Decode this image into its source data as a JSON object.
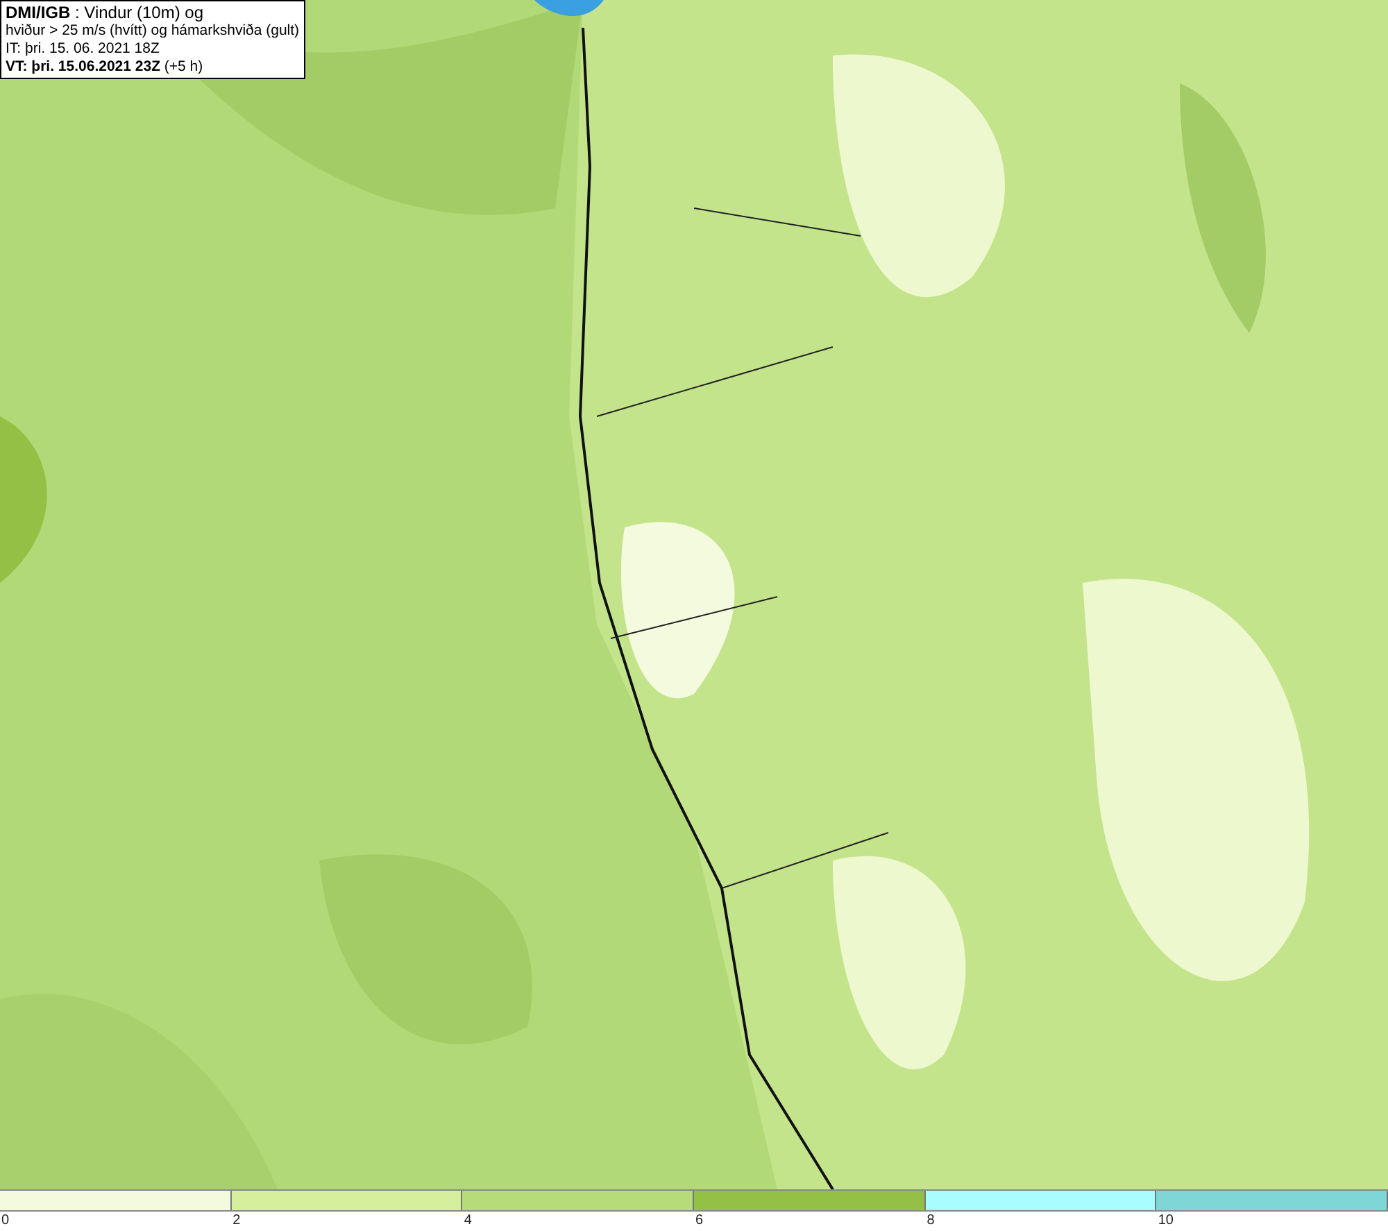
{
  "info_box": {
    "lines": [
      "**DMI/IGB** : Vindur (10m) og",
      "hviður > 25 m/s (hvítt) og hámarkshviða (gult)",
      "IT: þri. 15. 06. 2021 18Z",
      "**VT: þri. 15.06.2021 23Z** (+5 h)"
    ]
  },
  "legend": {
    "segments": [
      {
        "color": "#f4fadd"
      },
      {
        "color": "#d6ef9c"
      },
      {
        "color": "#b5dc78"
      },
      {
        "color": "#94c045"
      },
      {
        "color": "#a8fdfe"
      },
      {
        "color": "#7ed6d6"
      }
    ],
    "ticks": [
      "0",
      "2",
      "4",
      "6",
      "8",
      "10"
    ]
  }
}
